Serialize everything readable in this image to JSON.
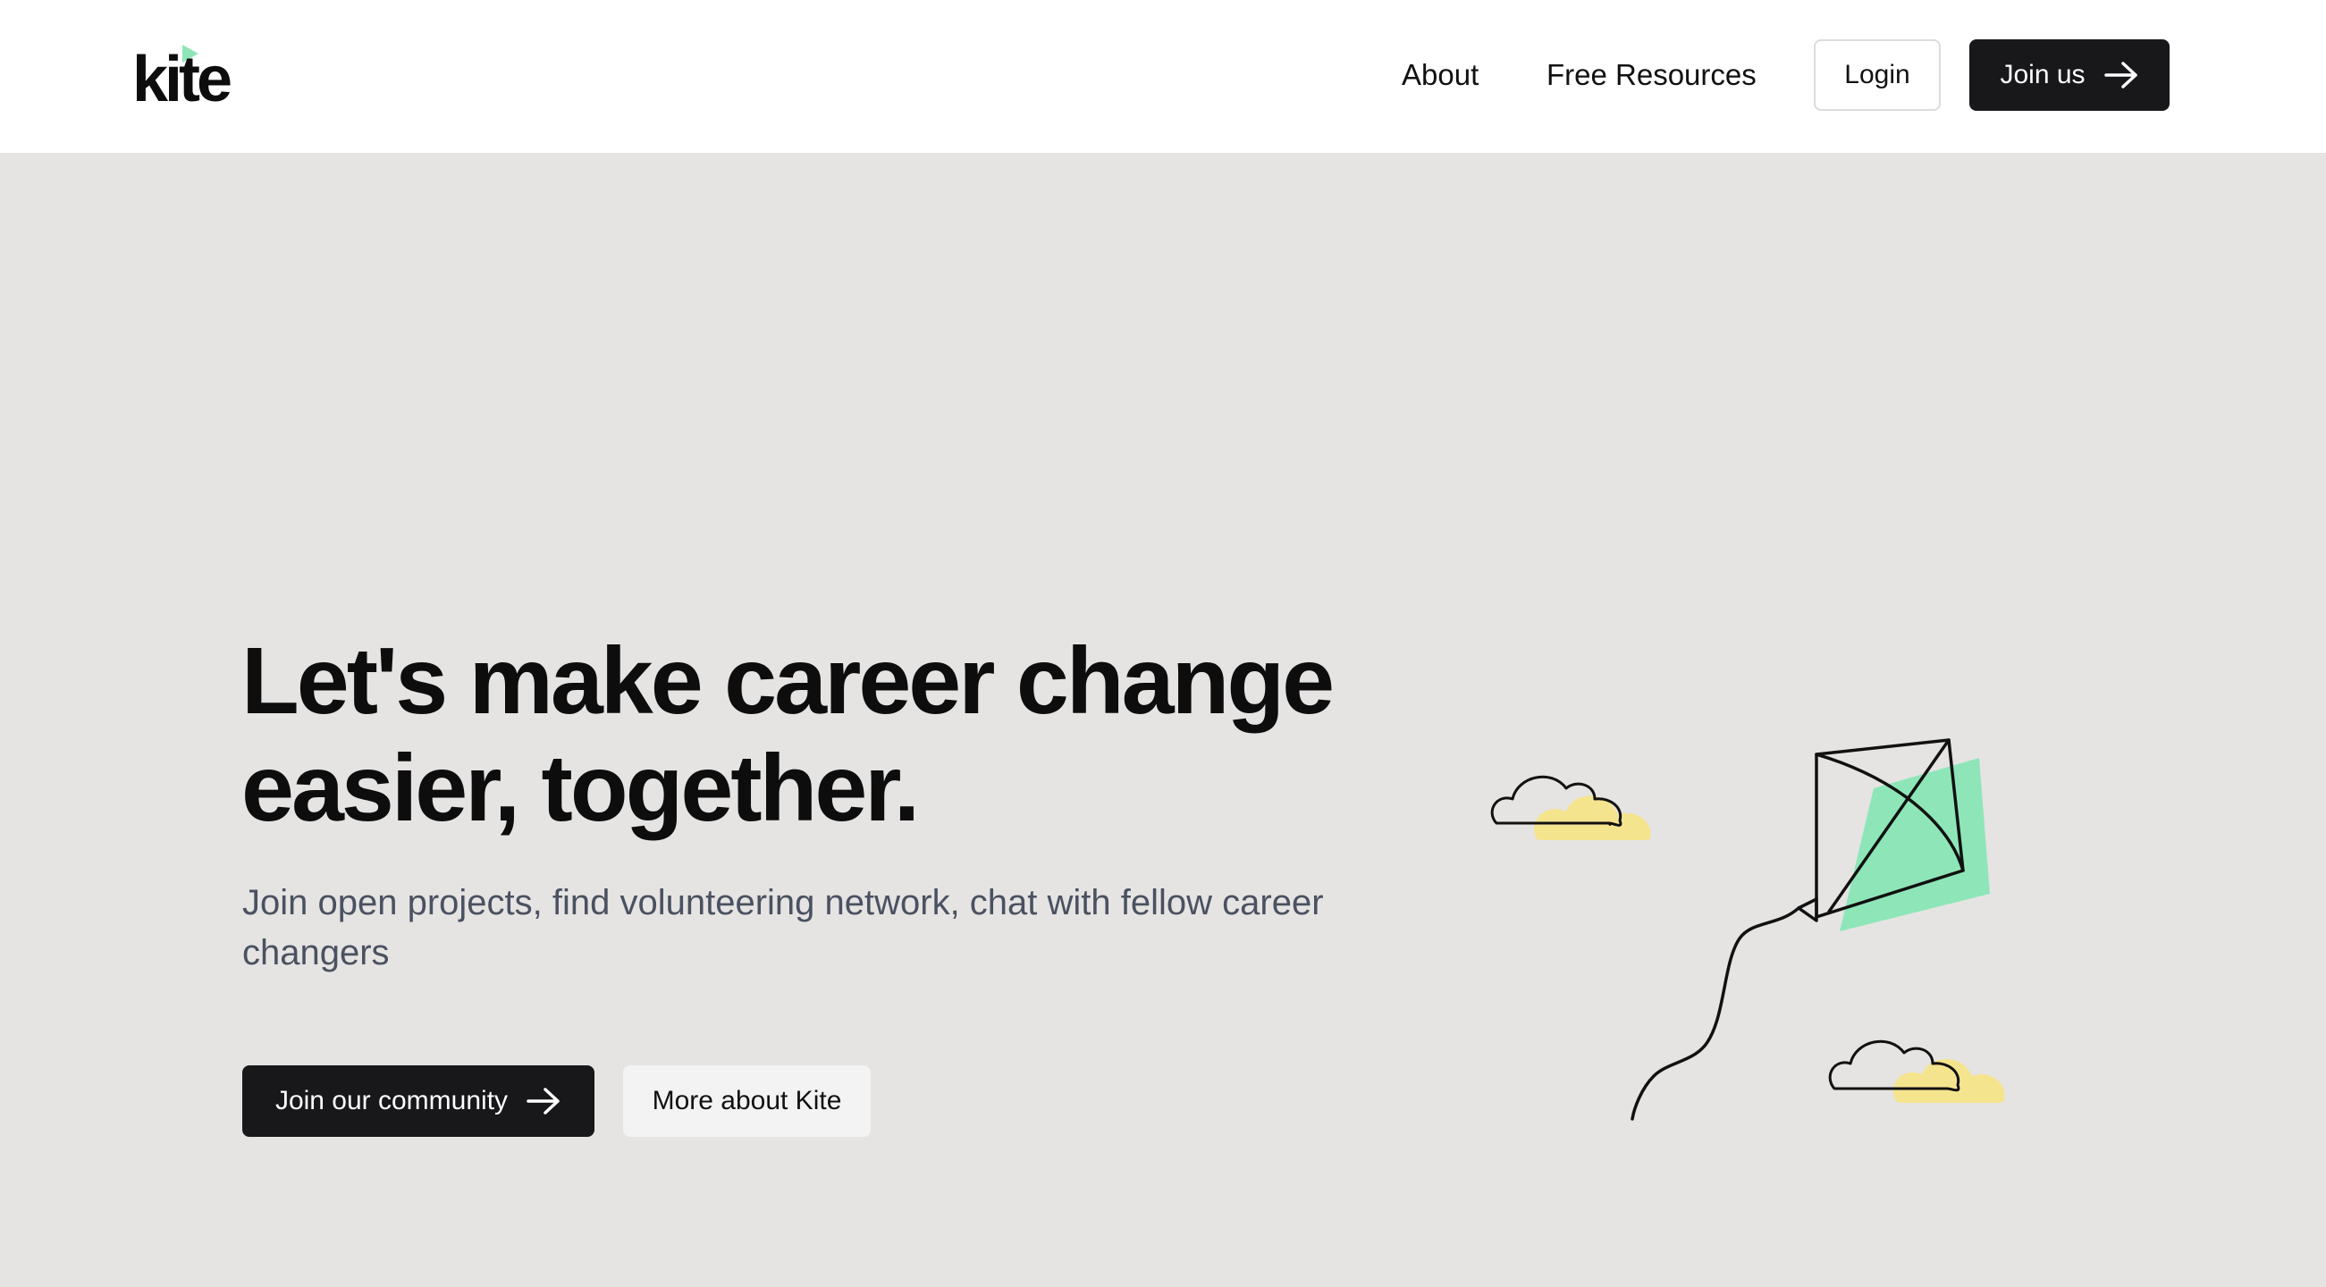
{
  "header": {
    "logo_text": "kite",
    "nav": {
      "about": "About",
      "free_resources": "Free Resources"
    },
    "login_label": "Login",
    "join_label": "Join us"
  },
  "hero": {
    "title": "Let's make career change easier, together.",
    "subtitle": "Join open projects, find volunteering network, chat with fellow career changers",
    "primary_cta": "Join our community",
    "secondary_cta": "More about Kite"
  },
  "colors": {
    "accent_green": "#8ee6b8",
    "cloud_yellow": "#f5e48e",
    "dark": "#18181b",
    "hero_background": "#e5e4e3"
  },
  "icons": {
    "arrow": "arrow-right-icon",
    "kite": "kite-illustration",
    "cloud": "cloud-illustration"
  }
}
